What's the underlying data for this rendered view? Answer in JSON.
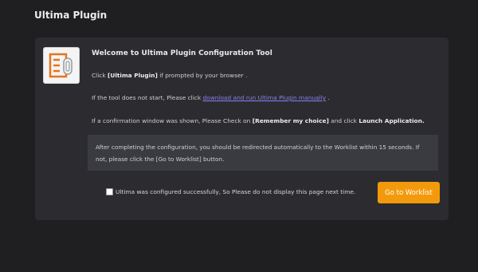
{
  "header": {
    "title": "Ultima Plugin"
  },
  "panel": {
    "welcome": "Welcome to Ultima Plugin Configuration Tool",
    "instr1": {
      "before": "Click ",
      "bold": "[Ultima Plugin]",
      "after": " if prompted by your browser ."
    },
    "instr2": {
      "before": "If the tool does not start, Please click ",
      "link": "download and run Ultima Plugin manually",
      "after": " ."
    },
    "instr3": {
      "before": "If a confirmation window was shown, Please Check on ",
      "bold1": "[Remember my choice]",
      "middle": " and click ",
      "bold2": "Launch Application."
    },
    "notice": "After completing the configuration, you should be redirected automatically to the Worklist within 15 seconds. If not, please click the [Go to Worklist] button.",
    "checkbox_label": "Ultima was configured successfully, So Please do not display this page next time.",
    "checkbox_checked": false,
    "button_label": "Go to Worklist"
  },
  "icons": {
    "logo": "ultima-plugin-logo-icon"
  },
  "colors": {
    "background": "#1f1f22",
    "panel": "#2c2c30",
    "notice": "#3a3a41",
    "link": "#8a7ef0",
    "button": "#f39a0c",
    "logo_accent": "#e8731c"
  }
}
